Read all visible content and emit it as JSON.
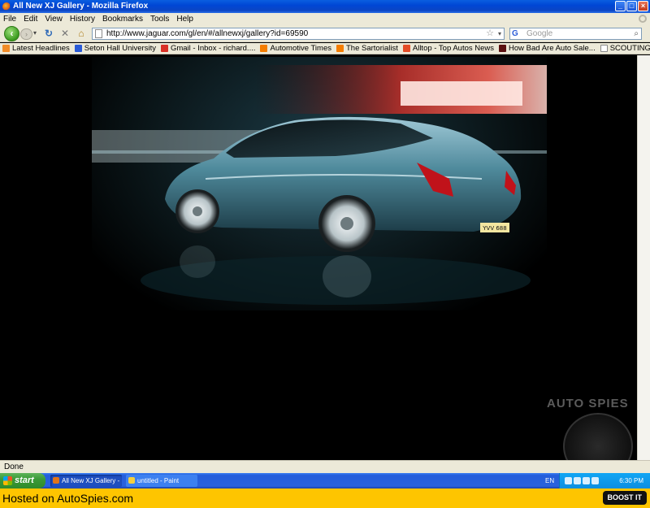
{
  "window": {
    "title": "All New XJ Gallery - Mozilla Firefox",
    "minimize": "_",
    "maximize": "□",
    "close": "×"
  },
  "menu": [
    "File",
    "Edit",
    "View",
    "History",
    "Bookmarks",
    "Tools",
    "Help"
  ],
  "nav": {
    "url": "http://www.jaguar.com/gl/en/#/allnewxj/gallery?id=69590",
    "search_placeholder": "Google"
  },
  "bookmarks": [
    {
      "label": "Latest Headlines",
      "color": "#f28c28"
    },
    {
      "label": "Seton Hall University",
      "color": "#2a5bd7"
    },
    {
      "label": "Gmail - Inbox - richard....",
      "color": "#d93025"
    },
    {
      "label": "Automotive Times",
      "color": "#f57d00"
    },
    {
      "label": "The Sartorialist",
      "color": "#f57d00"
    },
    {
      "label": "Alltop - Top Autos News",
      "color": "#e34c26"
    },
    {
      "label": "How Bad Are Auto Sale...",
      "color": "#5a1010"
    },
    {
      "label": "SCOUTING NY - www.s...",
      "color": "#ffffff"
    }
  ],
  "content": {
    "plate": "YVV 688",
    "watermark": "AUTO SPIES"
  },
  "status": "Done",
  "taskbar": {
    "start": "start",
    "tasks": [
      "All New XJ Gallery - M...",
      "untitled - Paint"
    ],
    "lang": "EN",
    "clock": "6:30 PM"
  },
  "footer": {
    "hosted": "Hosted on AutoSpies.com",
    "boost": "BOOST IT"
  }
}
